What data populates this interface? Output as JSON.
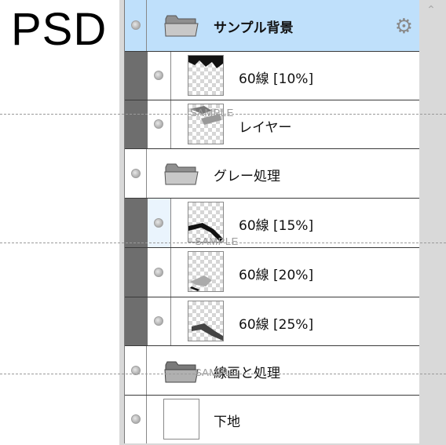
{
  "header_label": "PSD",
  "watermark": "SAMPLE",
  "layers": [
    {
      "name": "サンプル背景",
      "kind": "group",
      "selected": true
    },
    {
      "name": "60線 [10%]",
      "kind": "layer",
      "clipped": true
    },
    {
      "name": "レイヤー",
      "kind": "layer",
      "clipped": true
    },
    {
      "name": "グレー処理",
      "kind": "group"
    },
    {
      "name": "60線 [15%]",
      "kind": "layer",
      "clipped": true
    },
    {
      "name": "60線 [20%]",
      "kind": "layer",
      "clipped": true
    },
    {
      "name": "60線 [25%]",
      "kind": "layer",
      "clipped": true
    },
    {
      "name": "線画と処理",
      "kind": "group"
    },
    {
      "name": "下地",
      "kind": "layer"
    }
  ],
  "icons": {
    "visibility": "eye-dot-icon",
    "folder": "folder-icon",
    "settings": "gear-icon",
    "scroll": "chevron-up-icon"
  },
  "colors": {
    "selected_row": "#bfe0fb",
    "clip_bar": "#6e6e6e"
  }
}
